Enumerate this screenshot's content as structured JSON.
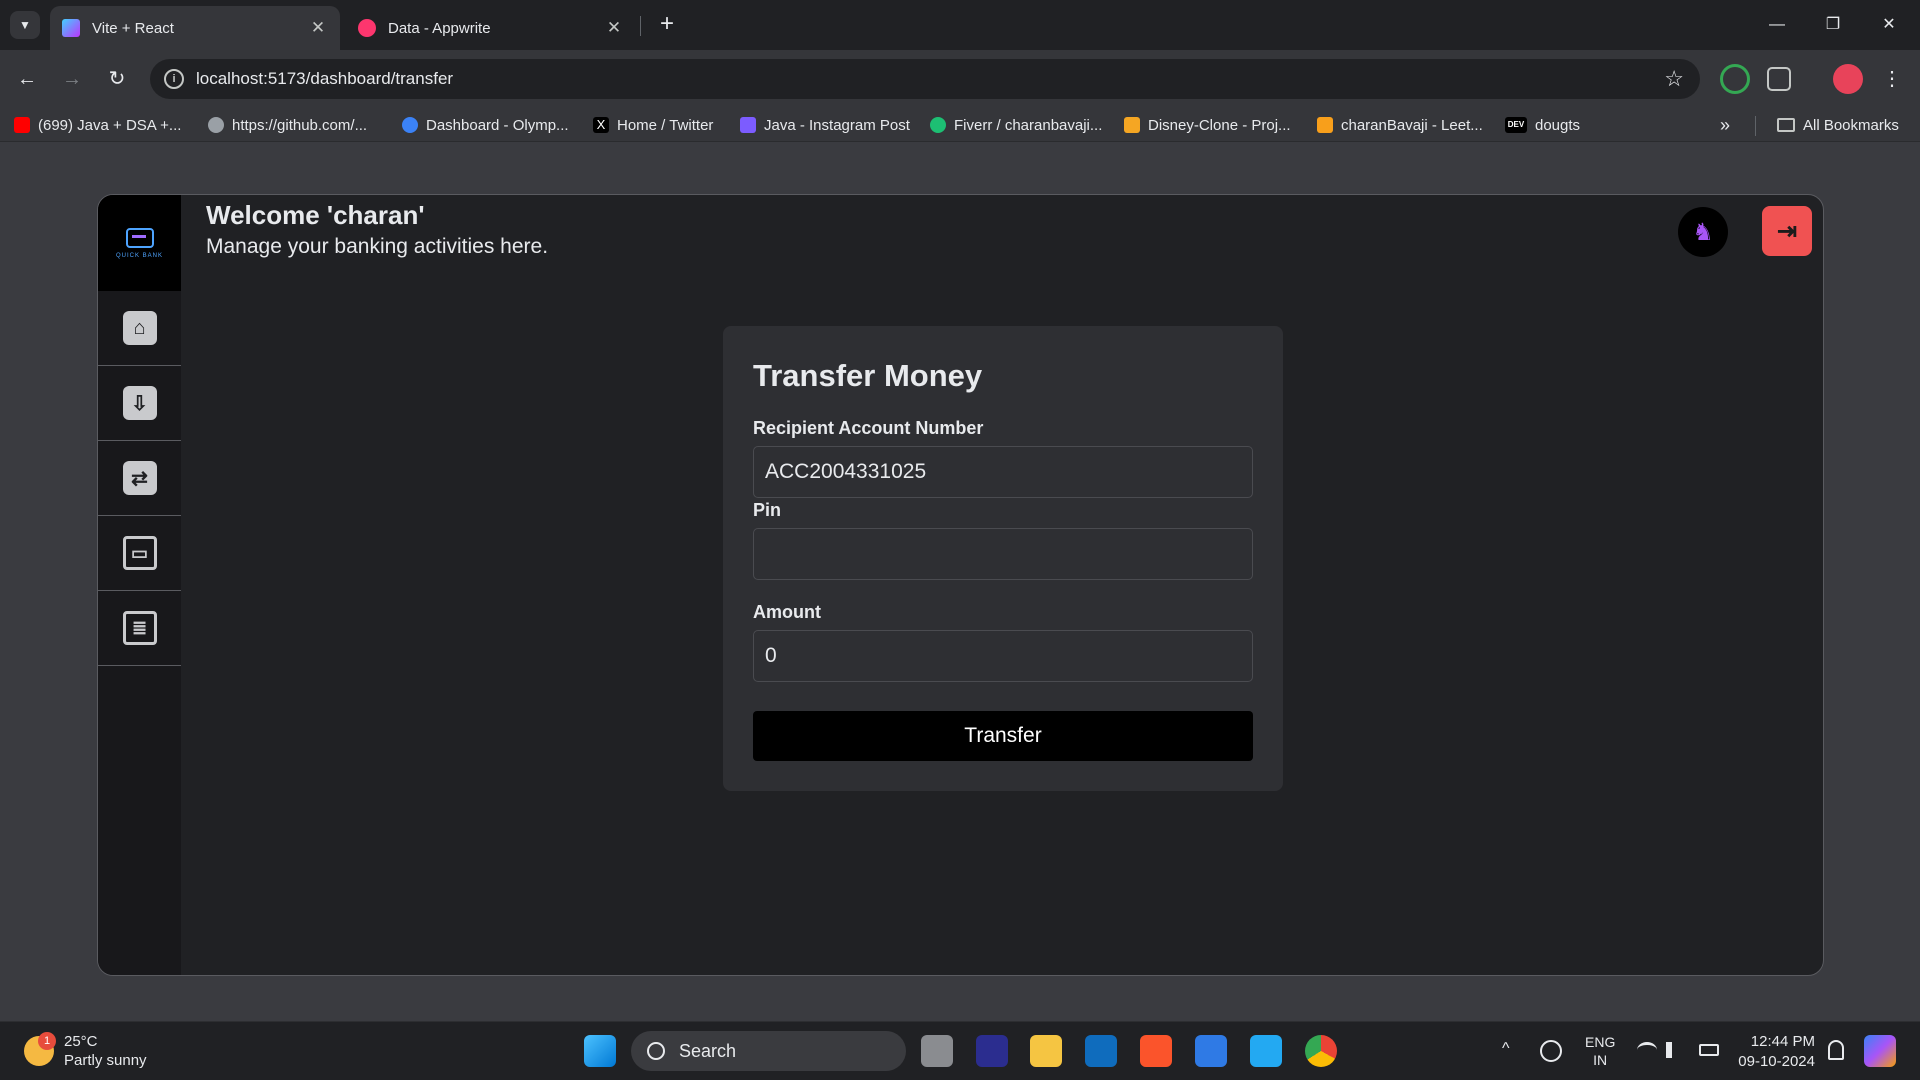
{
  "browser": {
    "tabs": [
      {
        "title": "Vite + React",
        "close": "✕"
      },
      {
        "title": "Data - Appwrite",
        "close": "✕"
      }
    ],
    "new_tab": "+",
    "window_controls": {
      "minimize": "—",
      "restore": "❐",
      "close": "✕"
    },
    "nav": {
      "back": "←",
      "forward": "→",
      "reload": "↻"
    },
    "url": "localhost:5173/dashboard/transfer",
    "info_symbol": "i",
    "star": "☆",
    "bookmarks": [
      {
        "label": "(699) Java + DSA +...",
        "color": "#ff0000"
      },
      {
        "label": "https://github.com/...",
        "color": "#9aa0a6"
      },
      {
        "label": "Dashboard - Olymp...",
        "color": "#3b82f6"
      },
      {
        "label": "Home / Twitter",
        "color": "#000000"
      },
      {
        "label": "Java - Instagram Post",
        "color": "#7c5cff"
      },
      {
        "label": "Fiverr / charanbavaji...",
        "color": "#1dbf73"
      },
      {
        "label": "Disney-Clone - Proj...",
        "color": "#f5a623"
      },
      {
        "label": "charanBavaji - Leet...",
        "color": "#e8eaed"
      },
      {
        "label": "dougts",
        "color": "#000000"
      }
    ],
    "more_bookmarks": "»",
    "all_bookmarks": "All Bookmarks"
  },
  "app": {
    "logo_text": "QUICK BANK",
    "welcome": "Welcome 'charan'",
    "subtitle": "Manage your banking activities here.",
    "sidebar": [
      {
        "name": "home",
        "glyph": "⌂"
      },
      {
        "name": "deposit",
        "glyph": "⇩"
      },
      {
        "name": "transfer",
        "glyph": "⇄"
      },
      {
        "name": "withdraw",
        "glyph": "▭"
      },
      {
        "name": "transactions",
        "glyph": "≣"
      }
    ],
    "logout_glyph": "⇥",
    "accent": "#f05252"
  },
  "form": {
    "title": "Transfer Money",
    "recipient_label": "Recipient Account Number",
    "recipient_value": "ACC2004331025",
    "pin_label": "Pin",
    "pin_value": "",
    "amount_label": "Amount",
    "amount_value": "0",
    "submit_label": "Transfer"
  },
  "taskbar": {
    "weather_temp": "25°C",
    "weather_desc": "Partly sunny",
    "weather_badge": "1",
    "search_label": "Search",
    "lang_top": "ENG",
    "lang_bottom": "IN",
    "time": "12:44 PM",
    "date": "09-10-2024",
    "chevron": "^"
  }
}
